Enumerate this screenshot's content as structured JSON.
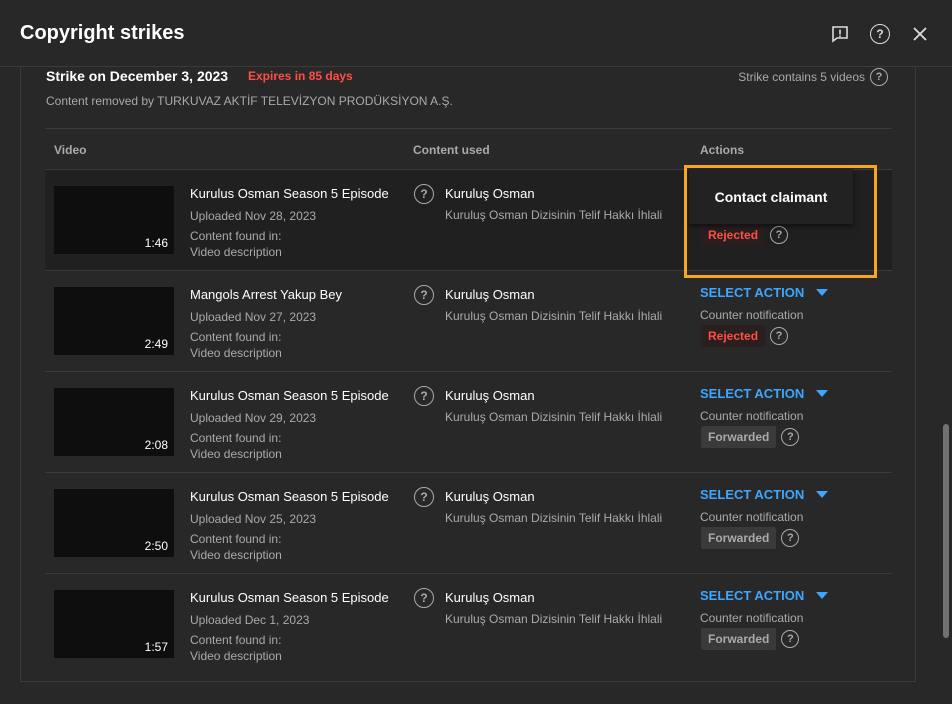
{
  "dialog": {
    "title": "Copyright strikes",
    "report_icon": "feedback-icon",
    "help_icon": "help-icon",
    "close_icon": "close-icon"
  },
  "strike": {
    "title": "Strike on December 3, 2023",
    "expires": "Expires in 85 days",
    "contains": "Strike contains 5 videos",
    "removed_by": "Content removed by TURKUVAZ AKTİF TELEVİZYON PRODÜKSİYON A.Ş."
  },
  "table": {
    "headers": {
      "video": "Video",
      "content_used": "Content used",
      "actions": "Actions"
    },
    "rows": [
      {
        "duration": "1:46",
        "title": "Kurulus Osman Season 5 Episode",
        "uploaded": "Uploaded Nov 28, 2023",
        "found_label": "Content found in:",
        "found_in": "Video description",
        "content_name": "Kuruluş Osman",
        "content_desc": "Kuruluş Osman Dizisinin Telif Hakkı İhlali",
        "action": "",
        "counter": "",
        "status": "Rejected"
      },
      {
        "duration": "2:49",
        "title": "Mangols Arrest Yakup Bey",
        "uploaded": "Uploaded Nov 27, 2023",
        "found_label": "Content found in:",
        "found_in": "Video description",
        "content_name": "Kuruluş Osman",
        "content_desc": "Kuruluş Osman Dizisinin Telif Hakkı İhlali",
        "action": "SELECT ACTION",
        "counter": "Counter notification",
        "status": "Rejected"
      },
      {
        "duration": "2:08",
        "title": "Kurulus Osman Season 5 Episode",
        "uploaded": "Uploaded Nov 29, 2023",
        "found_label": "Content found in:",
        "found_in": "Video description",
        "content_name": "Kuruluş Osman",
        "content_desc": "Kuruluş Osman Dizisinin Telif Hakkı İhlali",
        "action": "SELECT ACTION",
        "counter": "Counter notification",
        "status": "Forwarded"
      },
      {
        "duration": "2:50",
        "title": "Kurulus Osman Season 5 Episode",
        "uploaded": "Uploaded Nov 25, 2023",
        "found_label": "Content found in:",
        "found_in": "Video description",
        "content_name": "Kuruluş Osman",
        "content_desc": "Kuruluş Osman Dizisinin Telif Hakkı İhlali",
        "action": "SELECT ACTION",
        "counter": "Counter notification",
        "status": "Forwarded"
      },
      {
        "duration": "1:57",
        "title": "Kurulus Osman Season 5 Episode",
        "uploaded": "Uploaded Dec 1, 2023",
        "found_label": "Content found in:",
        "found_in": "Video description",
        "content_name": "Kuruluş Osman",
        "content_desc": "Kuruluş Osman Dizisinin Telif Hakkı İhlali",
        "action": "SELECT ACTION",
        "counter": "Counter notification",
        "status": "Forwarded"
      }
    ]
  },
  "popup": {
    "label": "Contact claimant"
  },
  "colors": {
    "accent": "#3ea6ff",
    "warning": "#ff4e45",
    "highlight": "#f5a623"
  }
}
